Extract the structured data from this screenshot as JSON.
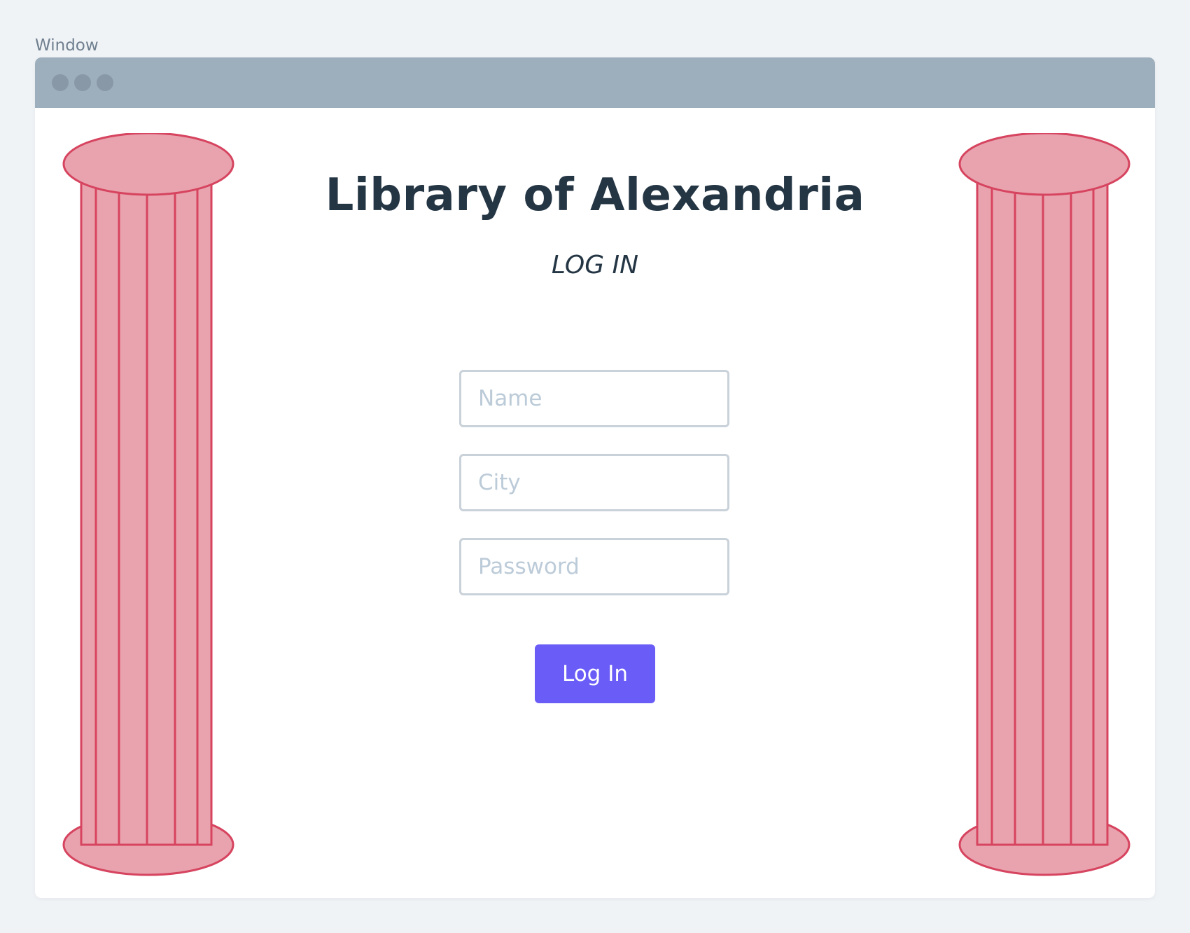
{
  "window": {
    "caption": "Window"
  },
  "page": {
    "title": "Library of Alexandria",
    "subtitle": "LOG IN"
  },
  "form": {
    "name_placeholder": "Name",
    "city_placeholder": "City",
    "password_placeholder": "Password",
    "submit_label": "Log In"
  },
  "colors": {
    "accent": "#6a5cf6",
    "pillar_fill": "#e9a3ae",
    "pillar_stroke": "#d6445f",
    "heading": "#243544",
    "titlebar": "#9daebc"
  },
  "icons": {
    "left_decoration": "column-pillar-icon",
    "right_decoration": "column-pillar-icon"
  }
}
